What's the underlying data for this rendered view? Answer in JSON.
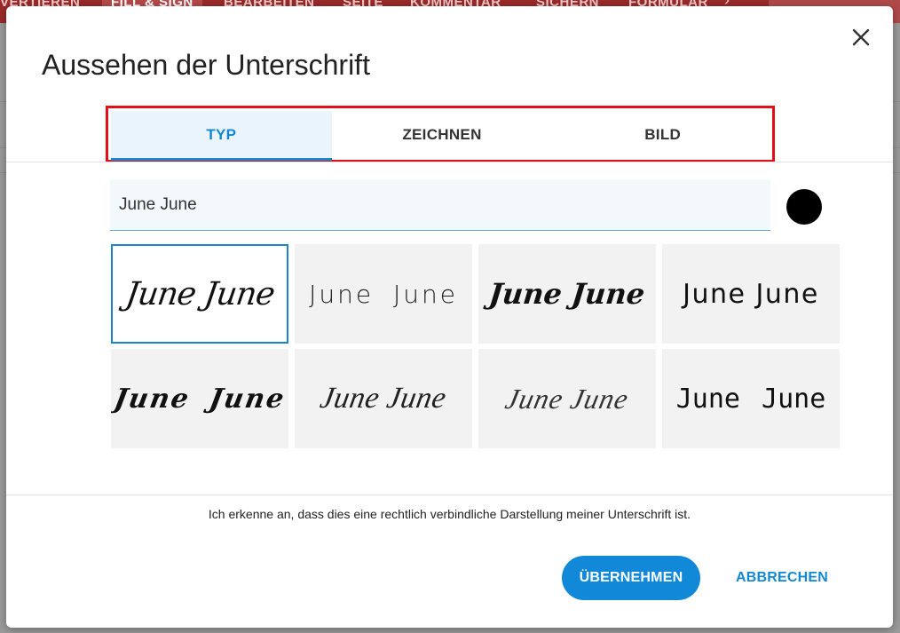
{
  "background": {
    "toolbar_tabs": [
      "VERTIEREN",
      "FILL & SIGN",
      "BEARBEITEN",
      "SEITE",
      "KOMMENTAR",
      "SICHERN",
      "FORMULAR"
    ],
    "active_tab": "FILL & SIGN"
  },
  "dialog": {
    "title": "Aussehen der Unterschrift",
    "close_icon": "close-icon",
    "tabs": [
      {
        "label": "TYP",
        "active": true
      },
      {
        "label": "ZEICHNEN",
        "active": false
      },
      {
        "label": "BILD",
        "active": false
      }
    ],
    "name_input_value": "June June",
    "selected_color": "#000000",
    "signatures": [
      {
        "text": "June June",
        "selected": true
      },
      {
        "text": "June  June",
        "selected": false
      },
      {
        "text": "June June",
        "selected": false
      },
      {
        "text": "June June",
        "selected": false
      },
      {
        "text": "June  June",
        "selected": false
      },
      {
        "text": "June June",
        "selected": false
      },
      {
        "text": "June June",
        "selected": false
      },
      {
        "text": "June  June",
        "selected": false
      }
    ],
    "disclaimer": "Ich erkenne an, dass dies eine rechtlich verbindliche Darstellung meiner Unterschrift ist.",
    "apply_label": "ÜBERNEHMEN",
    "cancel_label": "ABBRECHEN"
  },
  "colors": {
    "accent": "#1288d0",
    "highlight_frame": "#e0101a",
    "tab_active_bg": "#e9f4fd"
  }
}
